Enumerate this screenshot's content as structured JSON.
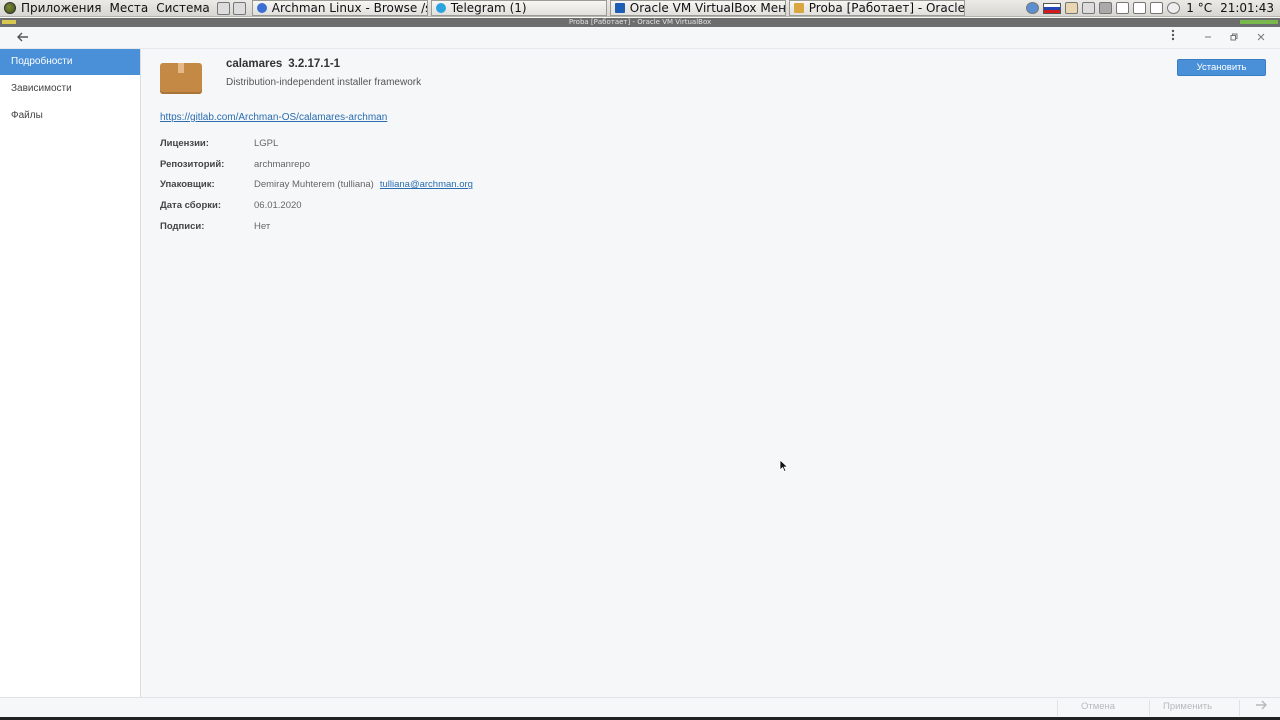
{
  "panel": {
    "menus": [
      "Приложения",
      "Места",
      "Система"
    ],
    "tasks": [
      {
        "label": "Archman Linux - Browse /st...",
        "color": "#3b6fd4"
      },
      {
        "label": "Telegram (1)",
        "color": "#2aa3e0"
      },
      {
        "label": "Oracle VM VirtualBox Мене...",
        "color": "#1d5fb4"
      },
      {
        "label": "Proba [Работает] - Oracle ...",
        "color": "#d9a640"
      }
    ],
    "weather": "1 °C",
    "clock": "21:01:43"
  },
  "vbox_title": "Proba [Работает] - Oracle VM VirtualBox",
  "sidebar": {
    "items": [
      {
        "label": "Подробности",
        "active": true
      },
      {
        "label": "Зависимости",
        "active": false
      },
      {
        "label": "Файлы",
        "active": false
      }
    ]
  },
  "package": {
    "name": "calamares",
    "version": "3.2.17.1-1",
    "description": "Distribution-independent installer framework",
    "install_label": "Установить",
    "url": "https://gitlab.com/Archman-OS/calamares-archman",
    "properties": [
      {
        "label": "Лицензии:",
        "value": "LGPL"
      },
      {
        "label": "Репозиторий:",
        "value": "archmanrepo"
      },
      {
        "label": "Упаковщик:",
        "value": "Demiray Muhterem (tulliana)",
        "link": "tulliana@archman.org"
      },
      {
        "label": "Дата сборки:",
        "value": "06.01.2020"
      },
      {
        "label": "Подписи:",
        "value": "Нет"
      }
    ]
  },
  "footer": {
    "cancel_label": "Отмена",
    "apply_label": "Применить"
  }
}
